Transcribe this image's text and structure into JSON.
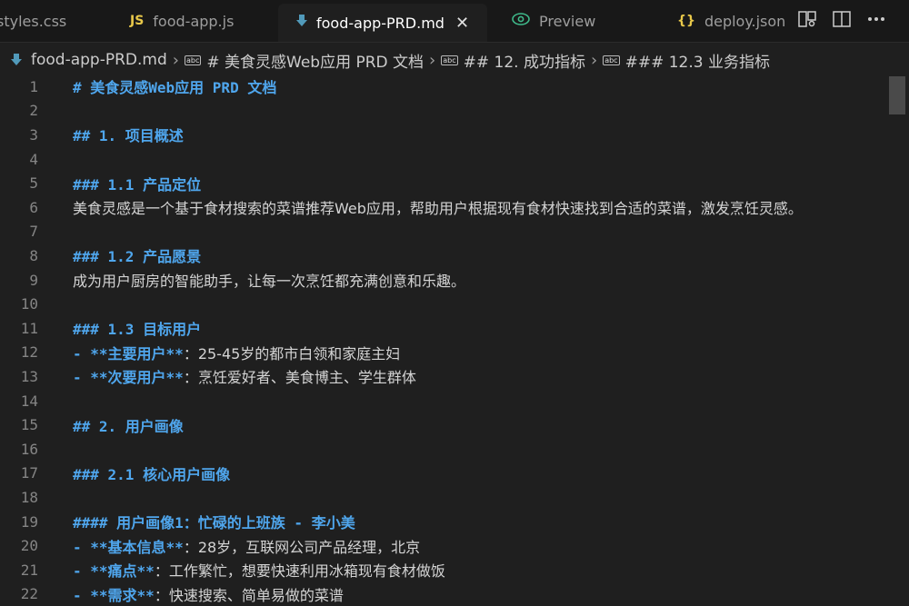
{
  "tabs": [
    {
      "label": "styles.css",
      "icon": "css-file-icon"
    },
    {
      "label": "food-app.js",
      "icon": "js-file-icon",
      "icon_text": "JS"
    },
    {
      "label": "food-app-PRD.md",
      "icon": "markdown-file-icon",
      "active": true
    },
    {
      "label": "Preview",
      "icon": "eye-icon"
    },
    {
      "label": "deploy.json",
      "icon": "json-file-icon",
      "icon_text": "{}"
    }
  ],
  "close_glyph": "✕",
  "breadcrumb": {
    "file": "food-app-PRD.md",
    "items": [
      "# 美食灵感Web应用 PRD 文档",
      "## 12. 成功指标",
      "### 12.3 业务指标"
    ]
  },
  "lines": [
    {
      "n": "1",
      "parts": [
        {
          "t": "# 美食灵感Web应用 PRD 文档",
          "c": "h"
        }
      ]
    },
    {
      "n": "2",
      "parts": []
    },
    {
      "n": "3",
      "parts": [
        {
          "t": "## 1. 项目概述",
          "c": "h"
        }
      ]
    },
    {
      "n": "4",
      "parts": []
    },
    {
      "n": "5",
      "parts": [
        {
          "t": "### 1.1 产品定位",
          "c": "h"
        }
      ]
    },
    {
      "n": "6",
      "parts": [
        {
          "t": "美食灵感是一个基于食材搜索的菜谱推荐Web应用，帮助用户根据现有食材快速找到合适的菜谱，激发烹饪灵感。",
          "c": "txt"
        }
      ]
    },
    {
      "n": "7",
      "parts": []
    },
    {
      "n": "8",
      "parts": [
        {
          "t": "### 1.2 产品愿景",
          "c": "h"
        }
      ]
    },
    {
      "n": "9",
      "parts": [
        {
          "t": "成为用户厨房的智能助手，让每一次烹饪都充满创意和乐趣。",
          "c": "txt"
        }
      ]
    },
    {
      "n": "10",
      "parts": []
    },
    {
      "n": "11",
      "parts": [
        {
          "t": "### 1.3 目标用户",
          "c": "h"
        }
      ]
    },
    {
      "n": "12",
      "parts": [
        {
          "t": "- **主要用户**",
          "c": "blue"
        },
        {
          "t": "：25-45岁的都市白领和家庭主妇",
          "c": "txt"
        }
      ]
    },
    {
      "n": "13",
      "parts": [
        {
          "t": "- **次要用户**",
          "c": "blue"
        },
        {
          "t": "：烹饪爱好者、美食博主、学生群体",
          "c": "txt"
        }
      ]
    },
    {
      "n": "14",
      "parts": []
    },
    {
      "n": "15",
      "parts": [
        {
          "t": "## 2. 用户画像",
          "c": "h"
        }
      ]
    },
    {
      "n": "16",
      "parts": []
    },
    {
      "n": "17",
      "parts": [
        {
          "t": "### 2.1 核心用户画像",
          "c": "h"
        }
      ]
    },
    {
      "n": "18",
      "parts": []
    },
    {
      "n": "19",
      "parts": [
        {
          "t": "#### 用户画像1：忙碌的上班族 - 李小美",
          "c": "h"
        }
      ]
    },
    {
      "n": "20",
      "parts": [
        {
          "t": "- **基本信息**",
          "c": "blue"
        },
        {
          "t": "：28岁，互联网公司产品经理，北京",
          "c": "txt"
        }
      ]
    },
    {
      "n": "21",
      "parts": [
        {
          "t": "- **痛点**",
          "c": "blue"
        },
        {
          "t": "：工作繁忙，想要快速利用冰箱现有食材做饭",
          "c": "txt"
        }
      ]
    },
    {
      "n": "22",
      "parts": [
        {
          "t": "- **需求**",
          "c": "blue"
        },
        {
          "t": "：快速搜索、简单易做的菜谱",
          "c": "txt"
        }
      ]
    }
  ]
}
